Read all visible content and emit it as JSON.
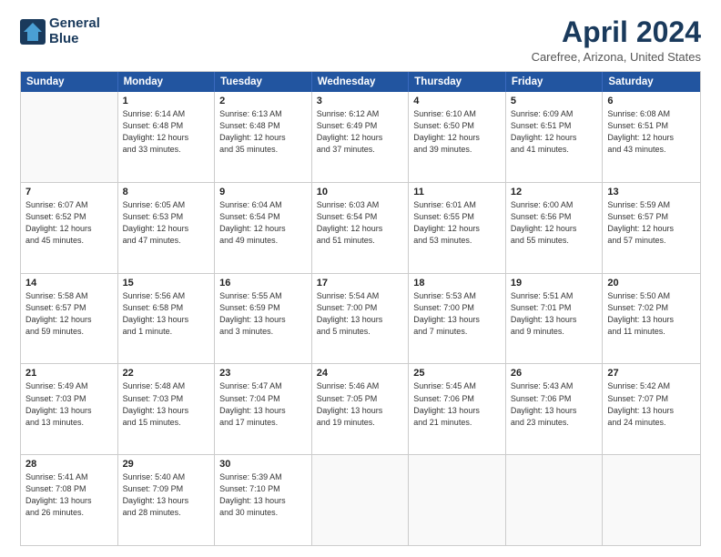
{
  "header": {
    "logo_line1": "General",
    "logo_line2": "Blue",
    "title": "April 2024",
    "subtitle": "Carefree, Arizona, United States"
  },
  "days_of_week": [
    "Sunday",
    "Monday",
    "Tuesday",
    "Wednesday",
    "Thursday",
    "Friday",
    "Saturday"
  ],
  "weeks": [
    [
      {
        "day": "",
        "info": ""
      },
      {
        "day": "1",
        "info": "Sunrise: 6:14 AM\nSunset: 6:48 PM\nDaylight: 12 hours\nand 33 minutes."
      },
      {
        "day": "2",
        "info": "Sunrise: 6:13 AM\nSunset: 6:48 PM\nDaylight: 12 hours\nand 35 minutes."
      },
      {
        "day": "3",
        "info": "Sunrise: 6:12 AM\nSunset: 6:49 PM\nDaylight: 12 hours\nand 37 minutes."
      },
      {
        "day": "4",
        "info": "Sunrise: 6:10 AM\nSunset: 6:50 PM\nDaylight: 12 hours\nand 39 minutes."
      },
      {
        "day": "5",
        "info": "Sunrise: 6:09 AM\nSunset: 6:51 PM\nDaylight: 12 hours\nand 41 minutes."
      },
      {
        "day": "6",
        "info": "Sunrise: 6:08 AM\nSunset: 6:51 PM\nDaylight: 12 hours\nand 43 minutes."
      }
    ],
    [
      {
        "day": "7",
        "info": "Sunrise: 6:07 AM\nSunset: 6:52 PM\nDaylight: 12 hours\nand 45 minutes."
      },
      {
        "day": "8",
        "info": "Sunrise: 6:05 AM\nSunset: 6:53 PM\nDaylight: 12 hours\nand 47 minutes."
      },
      {
        "day": "9",
        "info": "Sunrise: 6:04 AM\nSunset: 6:54 PM\nDaylight: 12 hours\nand 49 minutes."
      },
      {
        "day": "10",
        "info": "Sunrise: 6:03 AM\nSunset: 6:54 PM\nDaylight: 12 hours\nand 51 minutes."
      },
      {
        "day": "11",
        "info": "Sunrise: 6:01 AM\nSunset: 6:55 PM\nDaylight: 12 hours\nand 53 minutes."
      },
      {
        "day": "12",
        "info": "Sunrise: 6:00 AM\nSunset: 6:56 PM\nDaylight: 12 hours\nand 55 minutes."
      },
      {
        "day": "13",
        "info": "Sunrise: 5:59 AM\nSunset: 6:57 PM\nDaylight: 12 hours\nand 57 minutes."
      }
    ],
    [
      {
        "day": "14",
        "info": "Sunrise: 5:58 AM\nSunset: 6:57 PM\nDaylight: 12 hours\nand 59 minutes."
      },
      {
        "day": "15",
        "info": "Sunrise: 5:56 AM\nSunset: 6:58 PM\nDaylight: 13 hours\nand 1 minute."
      },
      {
        "day": "16",
        "info": "Sunrise: 5:55 AM\nSunset: 6:59 PM\nDaylight: 13 hours\nand 3 minutes."
      },
      {
        "day": "17",
        "info": "Sunrise: 5:54 AM\nSunset: 7:00 PM\nDaylight: 13 hours\nand 5 minutes."
      },
      {
        "day": "18",
        "info": "Sunrise: 5:53 AM\nSunset: 7:00 PM\nDaylight: 13 hours\nand 7 minutes."
      },
      {
        "day": "19",
        "info": "Sunrise: 5:51 AM\nSunset: 7:01 PM\nDaylight: 13 hours\nand 9 minutes."
      },
      {
        "day": "20",
        "info": "Sunrise: 5:50 AM\nSunset: 7:02 PM\nDaylight: 13 hours\nand 11 minutes."
      }
    ],
    [
      {
        "day": "21",
        "info": "Sunrise: 5:49 AM\nSunset: 7:03 PM\nDaylight: 13 hours\nand 13 minutes."
      },
      {
        "day": "22",
        "info": "Sunrise: 5:48 AM\nSunset: 7:03 PM\nDaylight: 13 hours\nand 15 minutes."
      },
      {
        "day": "23",
        "info": "Sunrise: 5:47 AM\nSunset: 7:04 PM\nDaylight: 13 hours\nand 17 minutes."
      },
      {
        "day": "24",
        "info": "Sunrise: 5:46 AM\nSunset: 7:05 PM\nDaylight: 13 hours\nand 19 minutes."
      },
      {
        "day": "25",
        "info": "Sunrise: 5:45 AM\nSunset: 7:06 PM\nDaylight: 13 hours\nand 21 minutes."
      },
      {
        "day": "26",
        "info": "Sunrise: 5:43 AM\nSunset: 7:06 PM\nDaylight: 13 hours\nand 23 minutes."
      },
      {
        "day": "27",
        "info": "Sunrise: 5:42 AM\nSunset: 7:07 PM\nDaylight: 13 hours\nand 24 minutes."
      }
    ],
    [
      {
        "day": "28",
        "info": "Sunrise: 5:41 AM\nSunset: 7:08 PM\nDaylight: 13 hours\nand 26 minutes."
      },
      {
        "day": "29",
        "info": "Sunrise: 5:40 AM\nSunset: 7:09 PM\nDaylight: 13 hours\nand 28 minutes."
      },
      {
        "day": "30",
        "info": "Sunrise: 5:39 AM\nSunset: 7:10 PM\nDaylight: 13 hours\nand 30 minutes."
      },
      {
        "day": "",
        "info": ""
      },
      {
        "day": "",
        "info": ""
      },
      {
        "day": "",
        "info": ""
      },
      {
        "day": "",
        "info": ""
      }
    ]
  ]
}
